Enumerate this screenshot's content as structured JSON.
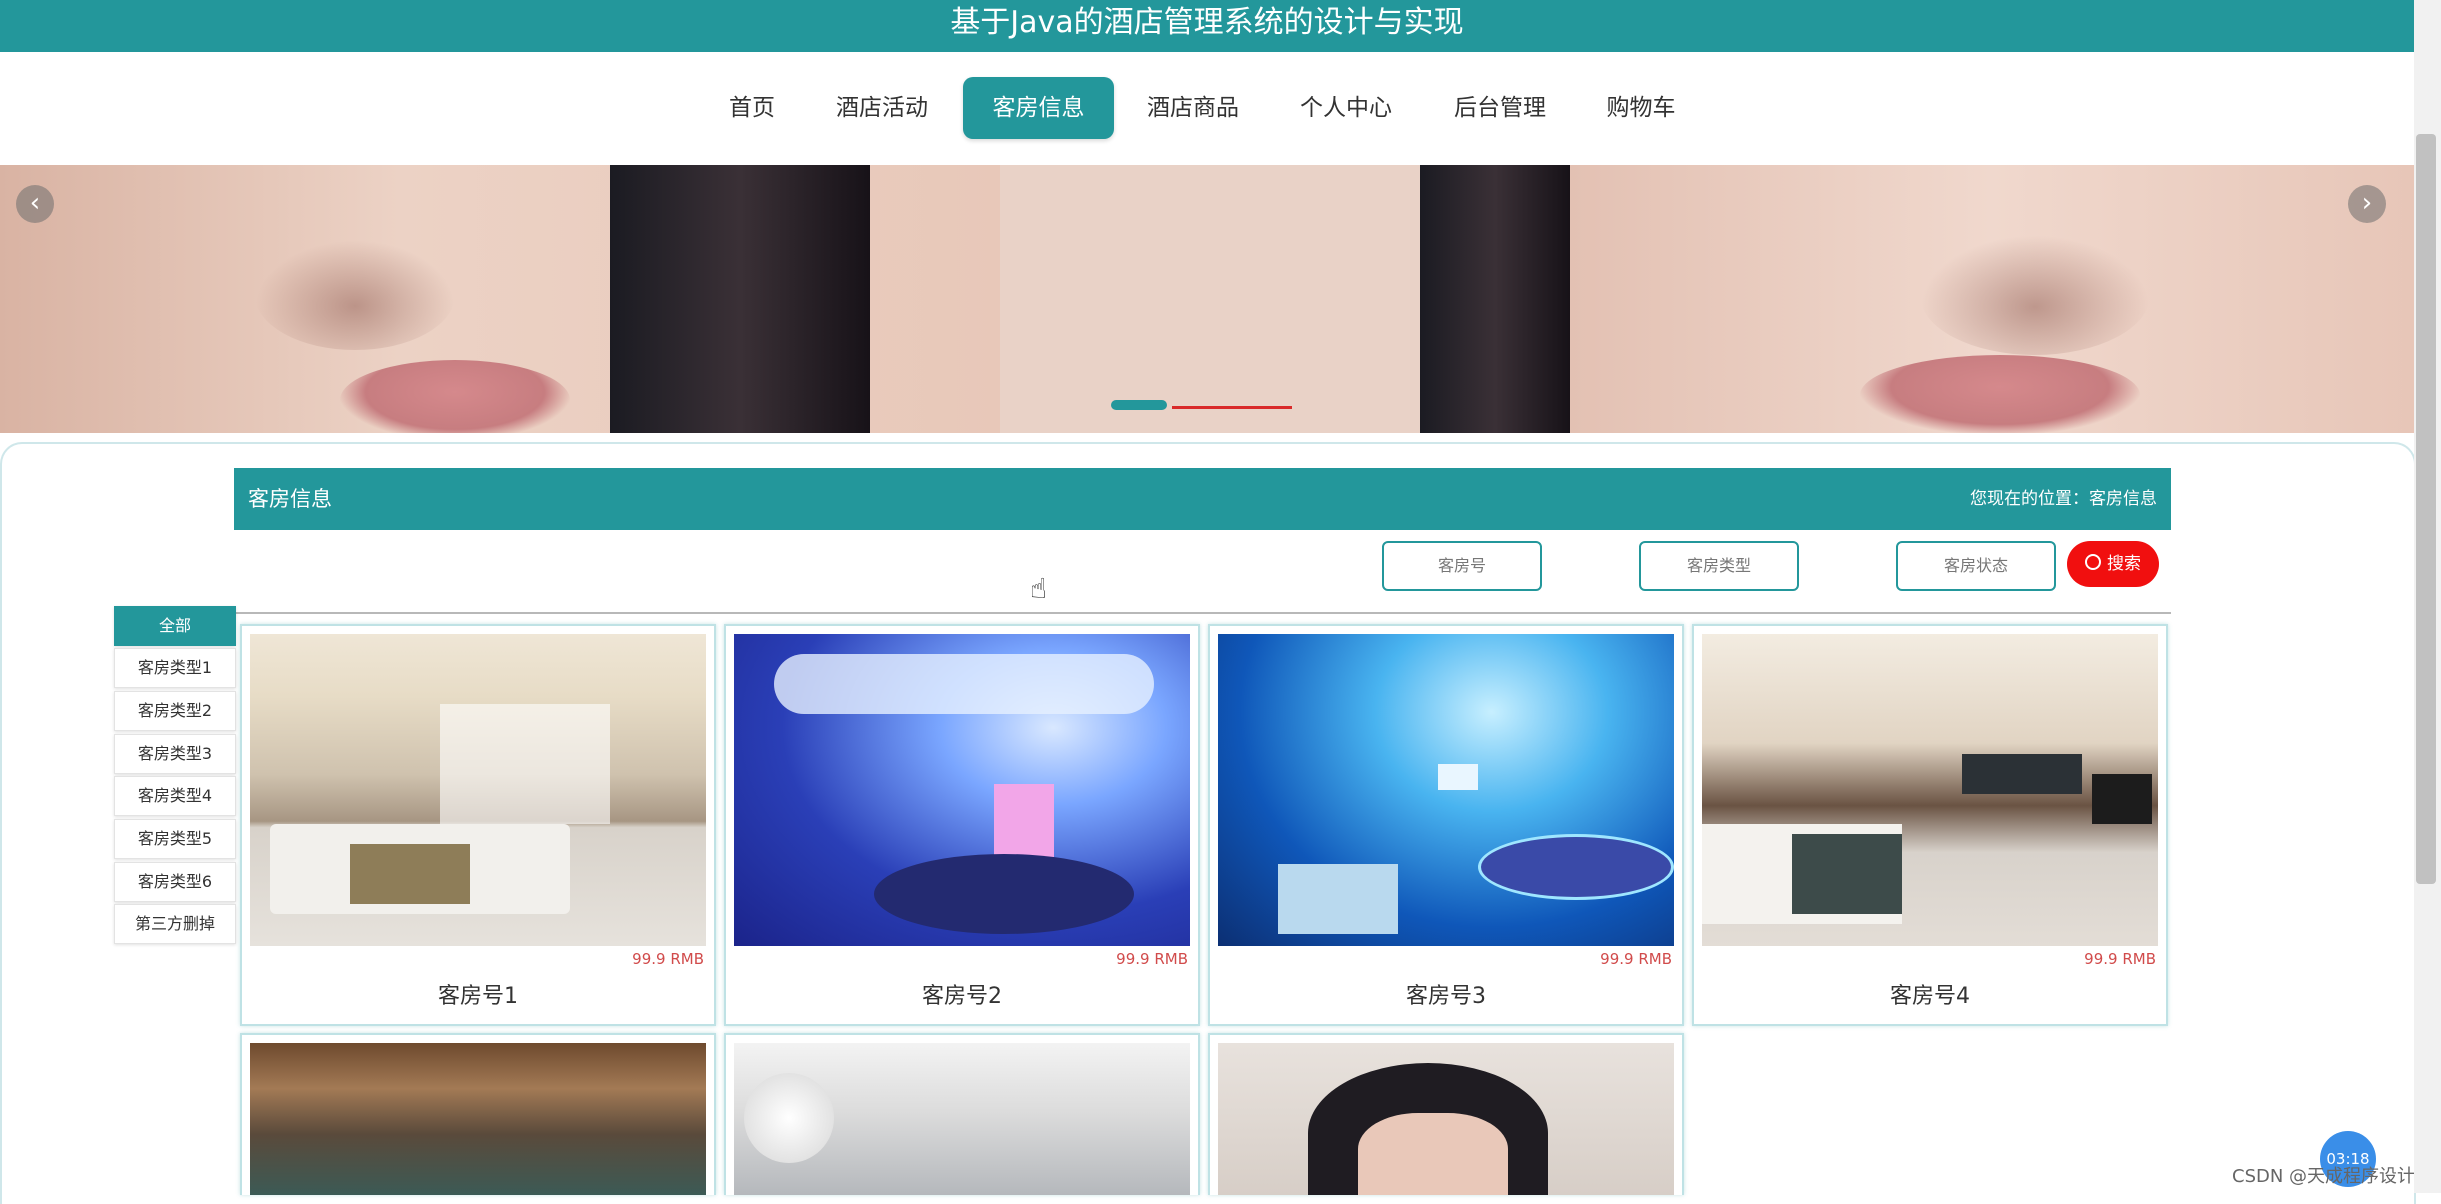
{
  "header": {
    "title": "基于Java的酒店管理系统的设计与实现"
  },
  "nav": {
    "items": [
      {
        "label": "首页"
      },
      {
        "label": "酒店活动"
      },
      {
        "label": "客房信息"
      },
      {
        "label": "酒店商品"
      },
      {
        "label": "个人中心"
      },
      {
        "label": "后台管理"
      },
      {
        "label": "购物车"
      }
    ],
    "active": "客房信息"
  },
  "banner": {
    "prev_icon": "chevron-left-icon",
    "next_icon": "chevron-right-icon"
  },
  "section": {
    "title": "客房信息",
    "location": "您现在的位置：客房信息"
  },
  "search": {
    "room_number_placeholder": "客房号",
    "room_type_placeholder": "客房类型",
    "room_status_placeholder": "客房状态",
    "button_label": "搜索",
    "icon": "search-icon"
  },
  "categories": [
    {
      "label": "全部",
      "active": true
    },
    {
      "label": "客房类型1"
    },
    {
      "label": "客房类型2"
    },
    {
      "label": "客房类型3"
    },
    {
      "label": "客房类型4"
    },
    {
      "label": "客房类型5"
    },
    {
      "label": "客房类型6"
    },
    {
      "label": "第三方删掉"
    }
  ],
  "rooms": [
    {
      "name": "客房号1",
      "price": "99.9 RMB"
    },
    {
      "name": "客房号2",
      "price": "99.9 RMB"
    },
    {
      "name": "客房号3",
      "price": "99.9 RMB"
    },
    {
      "name": "客房号4",
      "price": "99.9 RMB"
    }
  ],
  "overlay": {
    "timer": "03:18",
    "watermark": "CSDN @天成程序设计"
  },
  "colors": {
    "primary": "#23979b",
    "danger": "#f10f0f",
    "price": "#d14b4b"
  }
}
